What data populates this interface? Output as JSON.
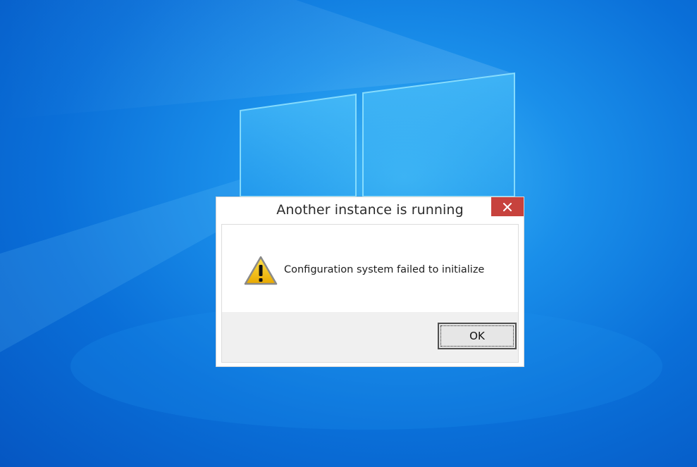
{
  "dialog": {
    "title": "Another instance is running",
    "message": "Configuration system failed to initialize",
    "ok_label": "OK",
    "close_icon": "close-icon",
    "message_icon": "warning-icon"
  },
  "colors": {
    "desktop_background": "#0a6fd8",
    "close_button": "#c7423d",
    "button_area": "#f0f0f0",
    "warning_yellow": "#f5c400"
  }
}
